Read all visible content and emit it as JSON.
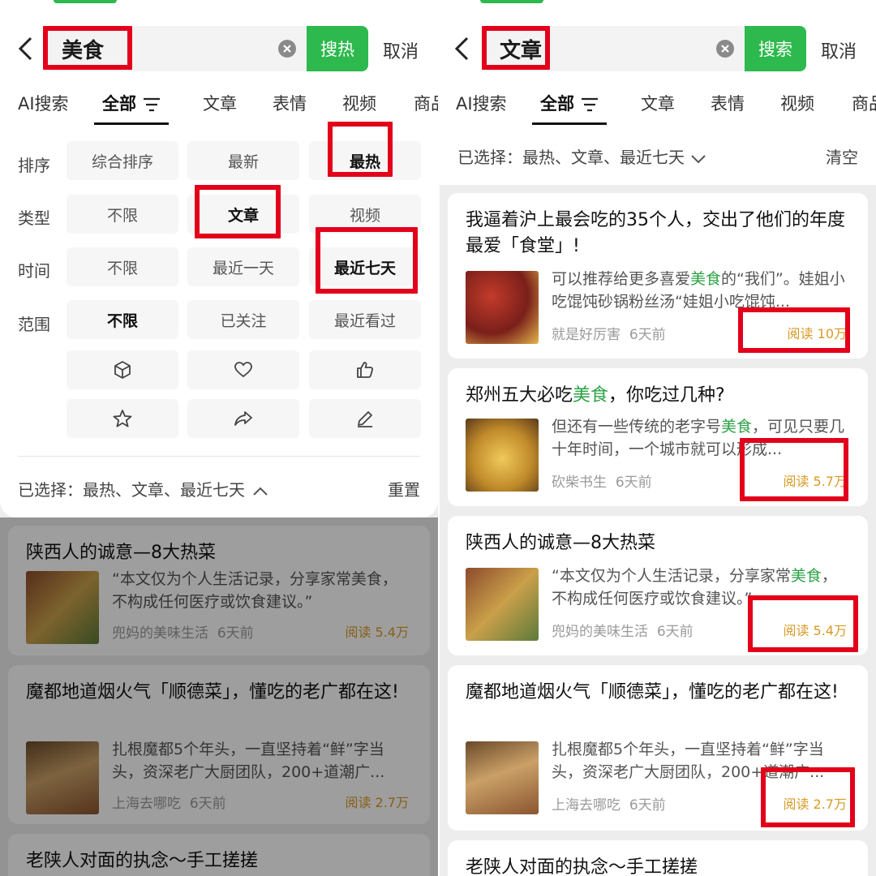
{
  "colors": {
    "accent": "#2db94d",
    "highlight": "#e3001b",
    "read_count": "#d99a24",
    "keyword": "#2ba245"
  },
  "tabs": [
    "AI搜索",
    "全部",
    "文章",
    "表情",
    "视频",
    "商品"
  ],
  "left": {
    "query": "美食",
    "search_button": "搜热",
    "cancel": "取消",
    "filters": {
      "rows": [
        {
          "label": "排序",
          "options": [
            "综合排序",
            "最新",
            "最热"
          ],
          "selected": "最热"
        },
        {
          "label": "类型",
          "options": [
            "不限",
            "文章",
            "视频"
          ],
          "selected": "文章"
        },
        {
          "label": "时间",
          "options": [
            "不限",
            "最近一天",
            "最近七天"
          ],
          "selected": "最近七天"
        },
        {
          "label": "范围",
          "options": [
            "不限",
            "已关注",
            "最近看过"
          ],
          "selected": "不限"
        }
      ],
      "icon_row_1": [
        "cube-icon",
        "heart-icon",
        "thumbs-up-icon"
      ],
      "icon_row_2": [
        "star-icon",
        "share-icon",
        "pencil-icon"
      ],
      "selected_summary": "已选择：最热、文章、最近七天",
      "reset": "重置"
    },
    "cards": [
      {
        "title": "陕西人的诚意—8大热菜",
        "snippet": "“本文仅为个人生活记录，分享家常美食，不构成任何医疗或饮食建议。”",
        "source": "兜妈的美味生活",
        "time": "6天前",
        "reads": "阅读 5.4万"
      },
      {
        "title": "魔都地道烟火气「顺德菜」，懂吃的老广都在这!",
        "snippet": "扎根魔都5个年头，一直坚持着“鲜”字当头，资深老广大厨团队，200+道潮广...",
        "source": "上海去哪吃",
        "time": "6天前",
        "reads": "阅读 2.7万"
      },
      {
        "title": "老陕人对面的执念～手工搓搓"
      }
    ]
  },
  "right": {
    "query": "文章",
    "search_button": "搜索",
    "cancel": "取消",
    "selected_summary": "已选择：最热、文章、最近七天",
    "clear": "清空",
    "cards": [
      {
        "title": "我逼着沪上最会吃的35个人，交出了他们的年度最爱「食堂」!",
        "snippet_pre": "可以推荐给更多喜爱",
        "snippet_key": "美食",
        "snippet_post": "的“我们”。娃姐小吃馄饨砂锅粉丝汤“娃姐小吃馄饨...",
        "source": "就是好厉害",
        "time": "6天前",
        "reads": "阅读 10万"
      },
      {
        "title_pre": "郑州五大必吃",
        "title_key": "美食",
        "title_post": "，你吃过几种?",
        "snippet_pre": "但还有一些传统的老字号",
        "snippet_key": "美食",
        "snippet_post": "，可见只要几十年时间，一个城市就可以形成...",
        "source": "砍柴书生",
        "time": "6天前",
        "reads": "阅读 5.7万"
      },
      {
        "title": "陕西人的诚意—8大热菜",
        "snippet_pre": "“本文仅为个人生活记录，分享家常",
        "snippet_key": "美食",
        "snippet_post": "，不构成任何医疗或饮食建议。”",
        "source": "兜妈的美味生活",
        "time": "6天前",
        "reads": "阅读 5.4万"
      },
      {
        "title": "魔都地道烟火气「顺德菜」，懂吃的老广都在这!",
        "snippet": "扎根魔都5个年头，一直坚持着“鲜”字当头，资深老广大厨团队，200+道潮广...",
        "source": "上海去哪吃",
        "time": "6天前",
        "reads": "阅读 2.7万"
      },
      {
        "title": "老陕人对面的执念～手工搓搓"
      }
    ]
  }
}
